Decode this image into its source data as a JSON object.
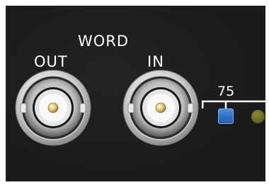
{
  "labels": {
    "word": "WORD",
    "out": "OUT",
    "in": "IN",
    "termination": "75"
  },
  "connectors": [
    {
      "name": "word-out",
      "type": "BNC"
    },
    {
      "name": "word-in",
      "type": "BNC"
    }
  ],
  "termination": {
    "switch_color": "#3a7ed6",
    "led_color": "#6a6a22",
    "led_state": "off"
  },
  "colors": {
    "panel": "#1b1b1b",
    "label": "#ffffff"
  }
}
